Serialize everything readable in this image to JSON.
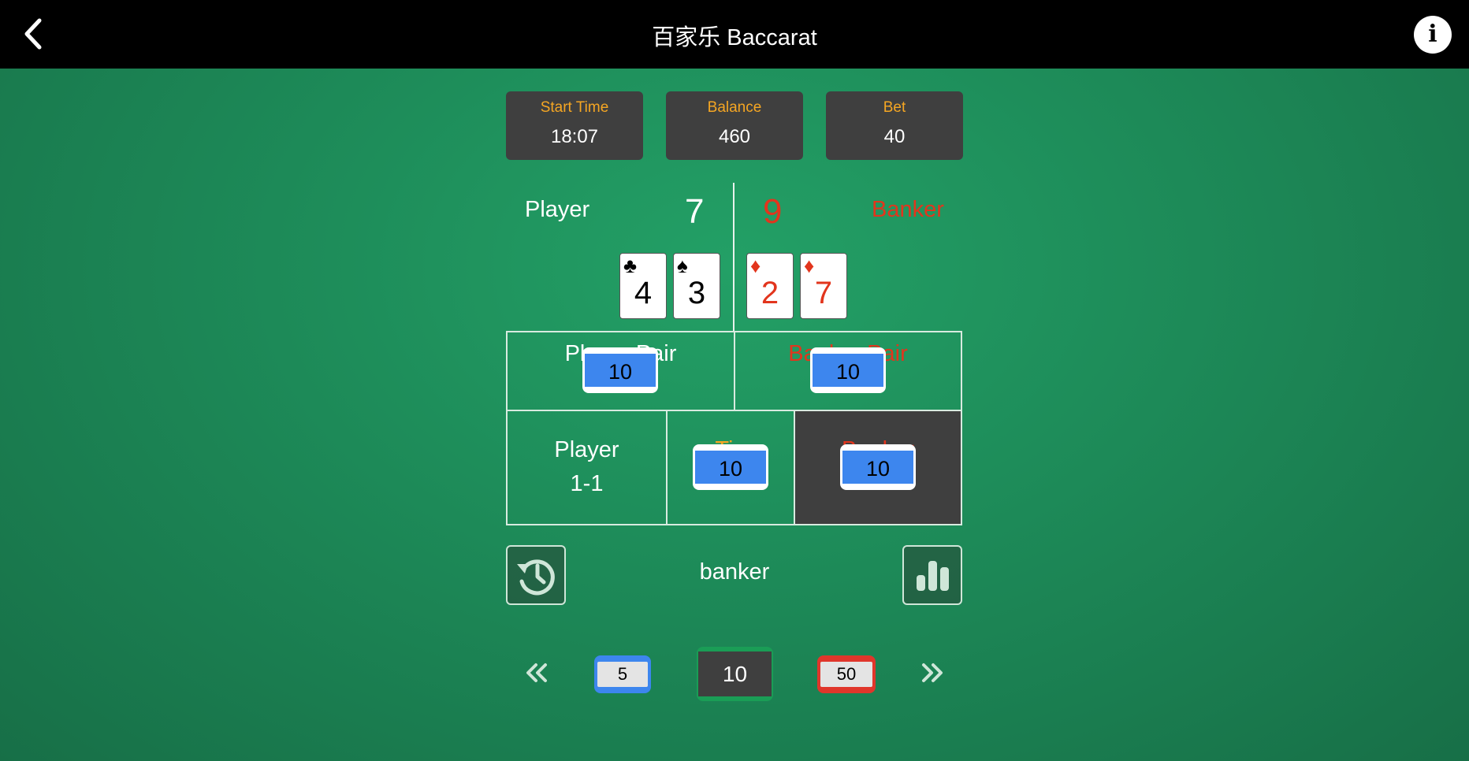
{
  "header": {
    "title": "百家乐 Baccarat",
    "back_icon": "chevron-left-icon",
    "info_icon": "info-icon"
  },
  "stats": [
    {
      "label": "Start Time",
      "value": "18:07"
    },
    {
      "label": "Balance",
      "value": "460"
    },
    {
      "label": "Bet",
      "value": "40"
    }
  ],
  "player": {
    "label": "Player",
    "score": "7",
    "cards": [
      {
        "suit": "♣",
        "rank": "4",
        "color": "black"
      },
      {
        "suit": "♠",
        "rank": "3",
        "color": "black"
      }
    ]
  },
  "banker": {
    "label": "Banker",
    "score": "9",
    "cards": [
      {
        "suit": "♦",
        "rank": "2",
        "color": "red"
      },
      {
        "suit": "♦",
        "rank": "7",
        "color": "red"
      }
    ]
  },
  "bet_zones": {
    "player_pair": {
      "label": "Player Pair",
      "chip": "10"
    },
    "banker_pair": {
      "label": "Banker Pair",
      "chip": "10"
    },
    "player": {
      "label": "Player",
      "odds": "1-1"
    },
    "tie": {
      "label": "Tie",
      "chip": "10"
    },
    "banker": {
      "label": "Banker",
      "chip": "10"
    }
  },
  "result_text": "banker",
  "history_icon": "history-icon",
  "stats_icon": "bar-chart-icon",
  "chip_selector": {
    "prev_icon": "double-chevron-left-icon",
    "next_icon": "double-chevron-right-icon",
    "chips": [
      "5",
      "10",
      "50"
    ],
    "selected": "10"
  },
  "colors": {
    "table_green": "#1d8a58",
    "red": "#e2351d",
    "orange": "#f5a623",
    "chip_blue": "#3d86ee",
    "chip_red": "#e0362b",
    "panel_dark": "#3f3f3f"
  }
}
